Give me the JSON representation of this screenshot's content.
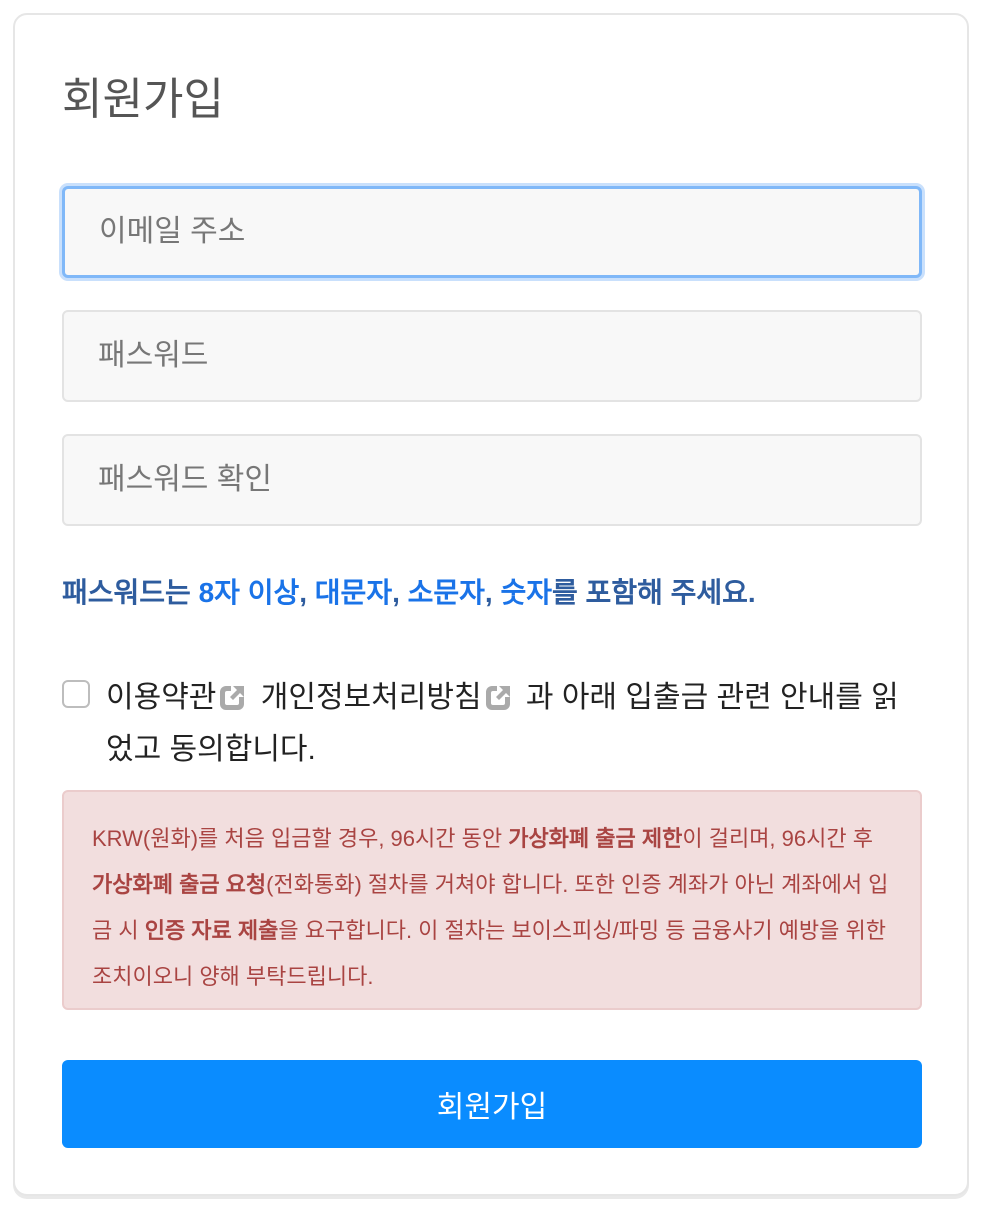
{
  "form": {
    "title": "회원가입",
    "email_placeholder": "이메일 주소",
    "password_placeholder": "패스워드",
    "password_confirm_placeholder": "패스워드 확인"
  },
  "password_hint": {
    "prefix": "패스워드는 ",
    "req_length": "8자 이상",
    "sep1": ", ",
    "req_upper": "대문자",
    "sep2": ", ",
    "req_lower": "소문자",
    "sep3": ", ",
    "req_digit": "숫자",
    "suffix": "를 포함해 주세요."
  },
  "agreement": {
    "checked": false,
    "terms_link": "이용약관",
    "privacy_link": "개인정보처리방침",
    "rest": " 과 아래 입출금 관련 안내를 읽었고 동의합니다.",
    "link_icon": "external-link-icon"
  },
  "notice": {
    "t1": "KRW(원화)를 처음 입금할 경우, 96시간 동안 ",
    "b1": "가상화폐 출금 제한",
    "t2": "이 걸리며, 96시간 후 ",
    "b2": "가상화폐 출금 요청",
    "t3": "(전화통화) 절차를 거쳐야 합니다. 또한 인증 계좌가 아닌 계좌에서 입금 시 ",
    "b3": "인증 자료 제출",
    "t4": "을 요구합니다. 이 절차는 보이스피싱/파밍 등 금융사기 예방을 위한 조치이오니 양해 부탁드립니다."
  },
  "submit_label": "회원가입",
  "colors": {
    "primary_button": "#0a8cff",
    "hint_text": "#2e5c9e",
    "hint_emphasis": "#1a73e8",
    "notice_bg": "#f2dede",
    "notice_text": "#a94442",
    "focus_ring": "#80b8f8"
  }
}
